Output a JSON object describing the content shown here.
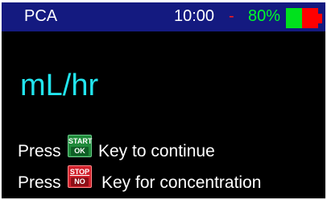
{
  "status_bar": {
    "mode": "PCA",
    "time": "10:00",
    "separator": "-",
    "battery_percent": "80%",
    "battery_level": 0.8,
    "colors": {
      "background": "#141a80",
      "separator": "#ff1a1a",
      "percent": "#00ff2a",
      "battery_charged": "#00e11d",
      "battery_low": "#ff0000"
    }
  },
  "main": {
    "unit": "mL/hr",
    "unit_color": "#22e5ef"
  },
  "instructions": [
    {
      "press": "Press",
      "key_top": "START",
      "key_bottom": "OK",
      "key_icon": "start-ok-key-icon",
      "key_color": "#1f8a3a",
      "rest": "Key to continue"
    },
    {
      "press": "Press",
      "key_top": "STOP",
      "key_bottom": "NO",
      "key_icon": "stop-no-key-icon",
      "key_color": "#d1202b",
      "rest": "Key for concentration"
    }
  ]
}
